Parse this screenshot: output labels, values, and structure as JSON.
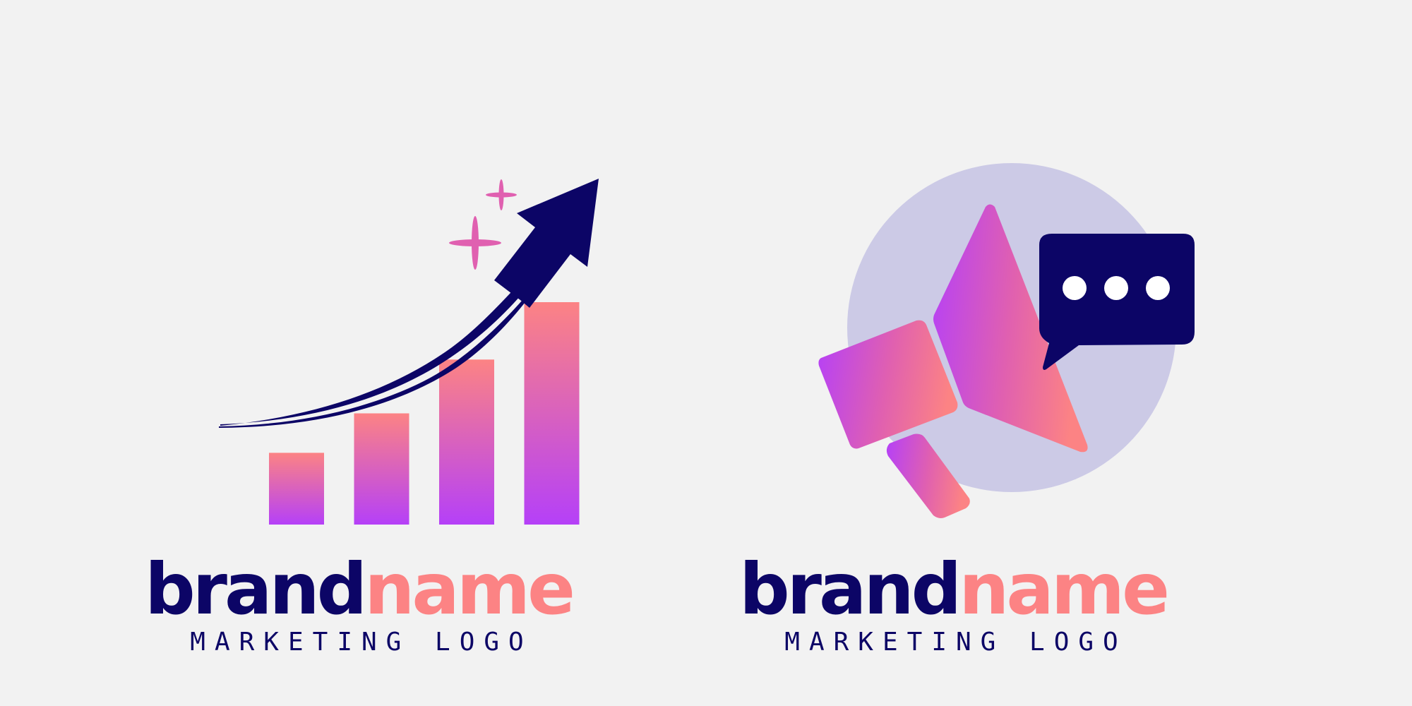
{
  "logos": [
    {
      "icon": "growth-chart-arrow-icon",
      "brand_part1": "brand",
      "brand_part2": "name",
      "tagline": "MARKETING LOGO",
      "chart_data": {
        "type": "bar",
        "values": [
          1.0,
          1.55,
          2.3,
          3.1
        ]
      }
    },
    {
      "icon": "megaphone-chat-icon",
      "brand_part1": "brand",
      "brand_part2": "name",
      "tagline": "MARKETING LOGO"
    }
  ],
  "colors": {
    "background": "#f2f2f2",
    "navy": "#0c0566",
    "coral": "#fc8384",
    "violet": "#b540f8",
    "pink": "#e060b0",
    "circle": "#cccae6",
    "white": "#ffffff"
  }
}
